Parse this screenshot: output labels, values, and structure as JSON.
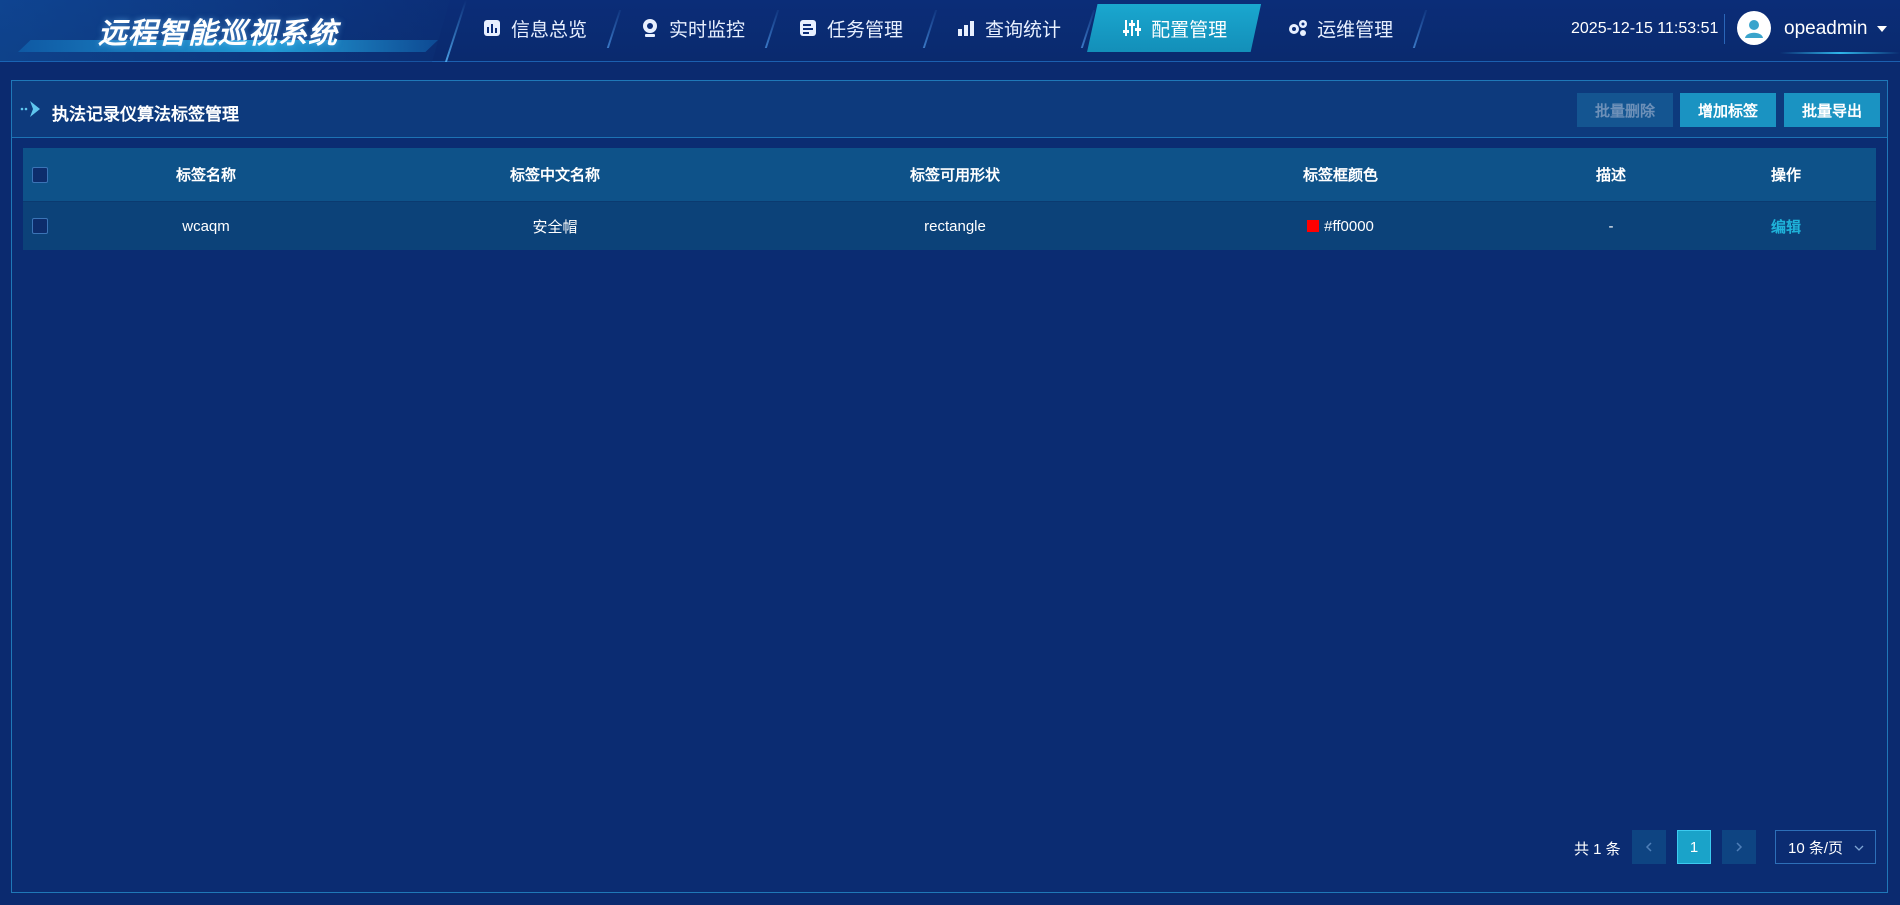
{
  "app": {
    "title": "远程智能巡视系统"
  },
  "nav": {
    "items": [
      {
        "label": "信息总览",
        "icon": "chart-icon"
      },
      {
        "label": "实时监控",
        "icon": "camera-icon"
      },
      {
        "label": "任务管理",
        "icon": "task-icon"
      },
      {
        "label": "查询统计",
        "icon": "stats-icon"
      },
      {
        "label": "配置管理",
        "icon": "sliders-icon",
        "active": true
      },
      {
        "label": "运维管理",
        "icon": "gears-icon"
      }
    ]
  },
  "header": {
    "datetime": "2025-12-15 11:53:51",
    "username": "opeadmin"
  },
  "panel": {
    "title": "执法记录仪算法标签管理",
    "buttons": {
      "batch_delete": "批量删除",
      "add_tag": "增加标签",
      "batch_export": "批量导出"
    }
  },
  "table": {
    "columns": {
      "name": "标签名称",
      "cn_name": "标签中文名称",
      "shape": "标签可用形状",
      "color": "标签框颜色",
      "desc": "描述",
      "op": "操作"
    },
    "rows": [
      {
        "name": "wcaqm",
        "cn_name": "安全帽",
        "shape": "rectangle",
        "color": "#ff0000",
        "desc": "-",
        "op": "编辑"
      }
    ]
  },
  "pagination": {
    "total": "共 1 条",
    "current_page": "1",
    "page_size": "10 条/页"
  },
  "colors": {
    "background": "#0b2a6f",
    "accent": "#1a93c2",
    "link": "#1fb2d9"
  }
}
